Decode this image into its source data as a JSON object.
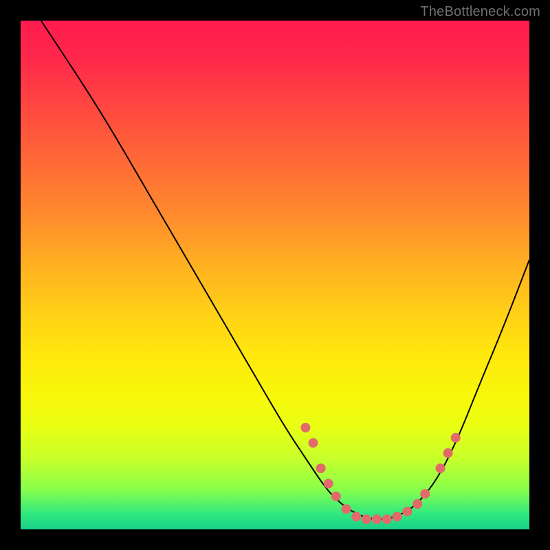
{
  "watermark": "TheBottleneck.com",
  "chart_data": {
    "type": "line",
    "title": "",
    "xlabel": "",
    "ylabel": "",
    "xlim": [
      0,
      100
    ],
    "ylim": [
      0,
      100
    ],
    "grid": false,
    "legend": false,
    "series": [
      {
        "name": "bottleneck-curve",
        "color": "#000000",
        "x": [
          4,
          10,
          17,
          24,
          31,
          38,
          45,
          52,
          56,
          60,
          63,
          66,
          69,
          72,
          75,
          78,
          82,
          86,
          90,
          95,
          100
        ],
        "y": [
          100,
          91,
          80,
          68,
          56,
          44,
          32,
          20,
          14,
          8,
          5,
          3,
          2,
          2,
          3,
          5,
          10,
          18,
          28,
          40,
          53
        ]
      }
    ],
    "markers": [
      {
        "name": "highlight-dots",
        "color": "#e26a6a",
        "radius": 7,
        "points": [
          {
            "x": 56,
            "y": 20
          },
          {
            "x": 57.5,
            "y": 17
          },
          {
            "x": 59,
            "y": 12
          },
          {
            "x": 60.5,
            "y": 9
          },
          {
            "x": 62,
            "y": 6.5
          },
          {
            "x": 64,
            "y": 4
          },
          {
            "x": 66,
            "y": 2.5
          },
          {
            "x": 68,
            "y": 2
          },
          {
            "x": 70,
            "y": 2
          },
          {
            "x": 72,
            "y": 2
          },
          {
            "x": 74,
            "y": 2.5
          },
          {
            "x": 76,
            "y": 3.5
          },
          {
            "x": 78,
            "y": 5
          },
          {
            "x": 79.5,
            "y": 7
          },
          {
            "x": 82.5,
            "y": 12
          },
          {
            "x": 84,
            "y": 15
          },
          {
            "x": 85.5,
            "y": 18
          }
        ]
      }
    ],
    "background_gradient": {
      "direction": "vertical",
      "stops": [
        {
          "pos": 0,
          "color": "#ff1a4f"
        },
        {
          "pos": 50,
          "color": "#ffb021"
        },
        {
          "pos": 75,
          "color": "#f8f80a"
        },
        {
          "pos": 100,
          "color": "#18d088"
        }
      ]
    }
  }
}
